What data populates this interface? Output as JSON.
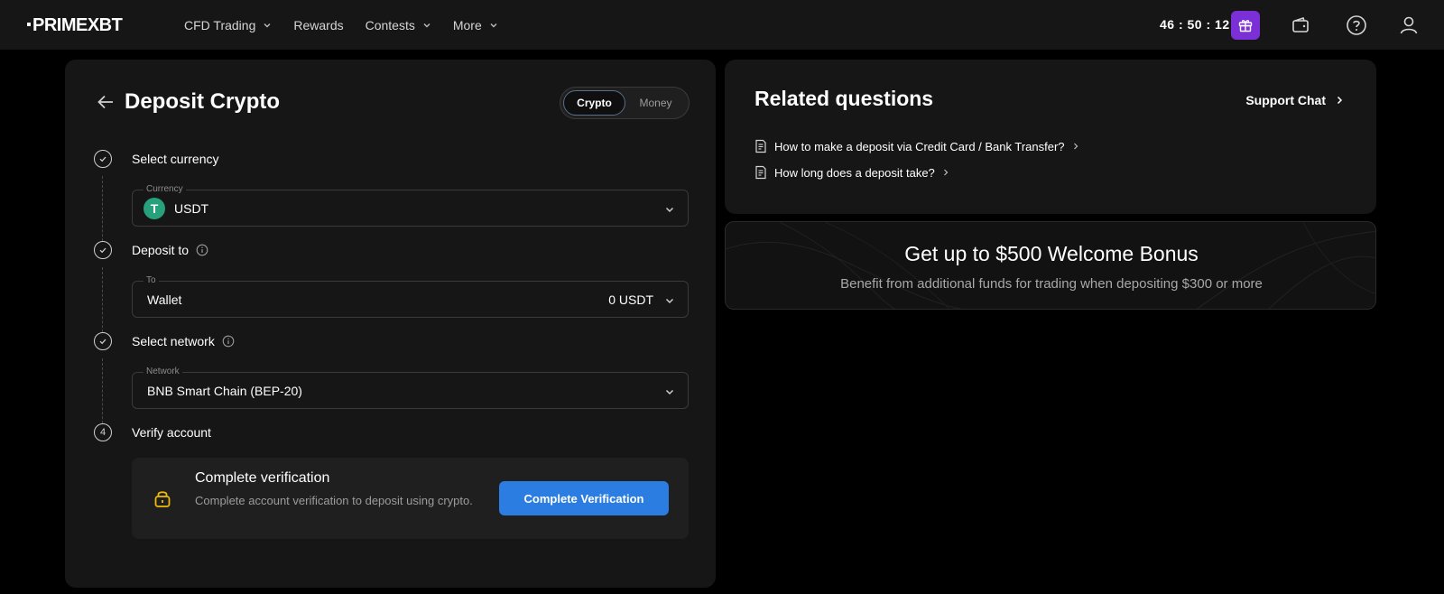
{
  "brand": {
    "logo_text": "PRIMEXBT"
  },
  "nav": {
    "items": [
      {
        "label": "CFD Trading",
        "has_dropdown": true
      },
      {
        "label": "Rewards",
        "has_dropdown": false
      },
      {
        "label": "Contests",
        "has_dropdown": true
      },
      {
        "label": "More",
        "has_dropdown": true
      }
    ],
    "timer": "46 : 50 : 12",
    "icons": [
      "gift-icon",
      "wallet-icon",
      "help-icon",
      "user-icon"
    ]
  },
  "deposit": {
    "title": "Deposit Crypto",
    "toggle": {
      "options": [
        "Crypto",
        "Money"
      ],
      "selected": "Crypto"
    },
    "steps": [
      {
        "marker": "check",
        "label": "Select currency",
        "field_legend": "Currency",
        "field_value": "USDT",
        "field_icon": "tether-icon"
      },
      {
        "marker": "check",
        "label": "Deposit to",
        "has_info": true,
        "field_legend": "To",
        "field_value": "Wallet",
        "field_right": "0 USDT"
      },
      {
        "marker": "check",
        "label": "Select network",
        "has_info": true,
        "field_legend": "Network",
        "field_value": "BNB Smart Chain (BEP-20)"
      },
      {
        "marker": "4",
        "label": "Verify account"
      }
    ],
    "verification": {
      "title": "Complete verification",
      "description": "Complete account verification to deposit using crypto.",
      "button_label": "Complete Verification"
    }
  },
  "related": {
    "title": "Related questions",
    "support_label": "Support Chat",
    "questions": [
      "How to make a deposit via Credit Card / Bank Transfer?",
      "How long does a deposit take?"
    ]
  },
  "bonus": {
    "title": "Get up to $500 Welcome Bonus",
    "subtitle": "Benefit from additional funds for trading when depositing $300 or more"
  },
  "colors": {
    "background": "#000000",
    "card": "#161616",
    "accent_blue": "#2b7de1",
    "gift_purple": "#7b2fd6",
    "tether_green": "#26a17b",
    "lock_yellow": "#f0b90b"
  }
}
